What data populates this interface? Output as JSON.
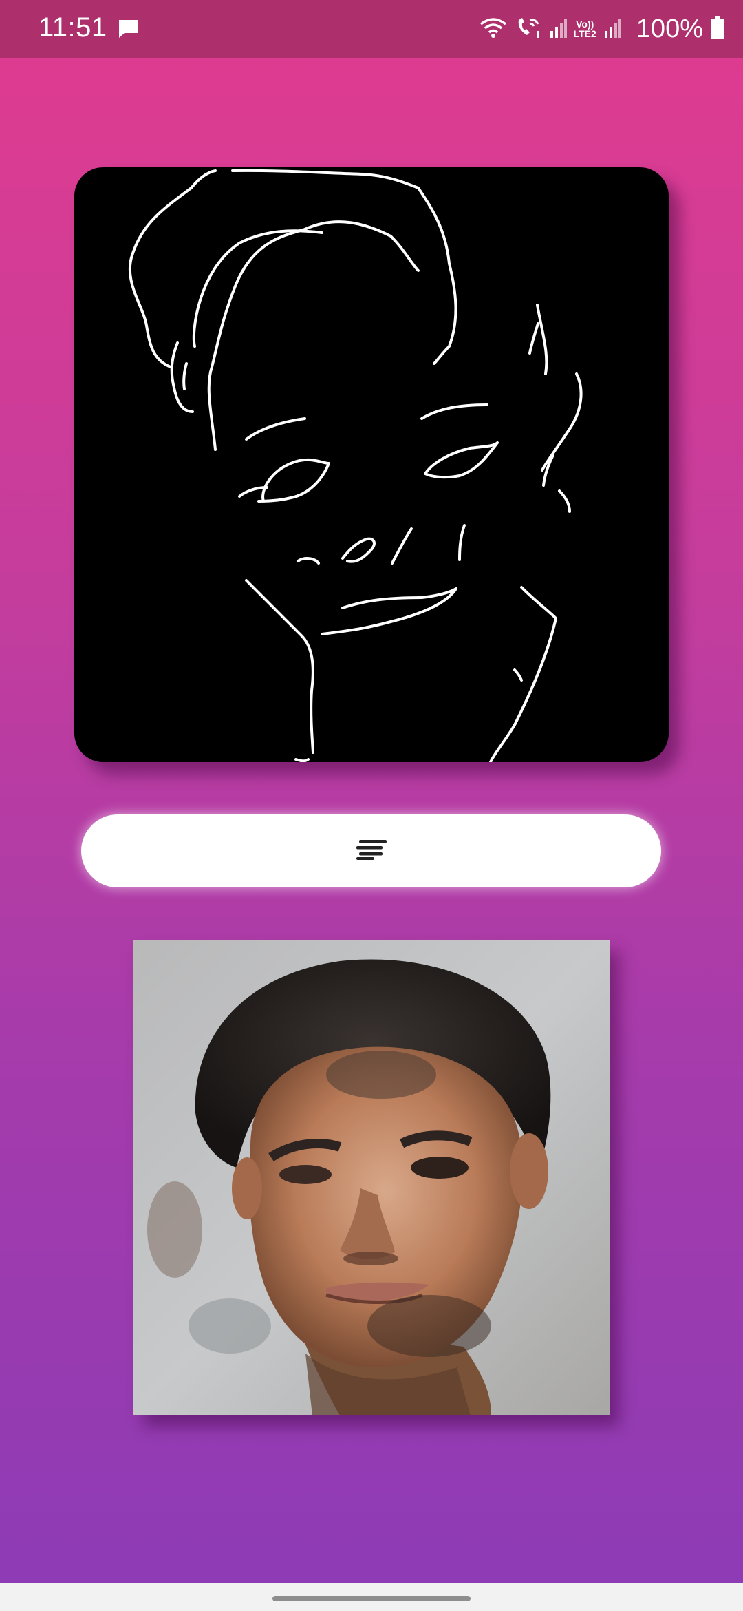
{
  "status_bar": {
    "time": "11:51",
    "battery_text": "100%",
    "volte_top": "Vo))",
    "volte_bottom": "LTE2",
    "icons": [
      "message-icon",
      "wifi-icon",
      "wifi-call-icon",
      "signal-icon",
      "volte-icon",
      "battery-icon"
    ]
  },
  "sketch_canvas": {
    "background": "#000000",
    "stroke_color": "#ffffff"
  },
  "generate_button": {
    "icon": "sort-lines-icon"
  },
  "colors": {
    "gradient_top": "#e03b8f",
    "gradient_bottom": "#8c3bb6",
    "status_bar": "#ad2f6c"
  }
}
